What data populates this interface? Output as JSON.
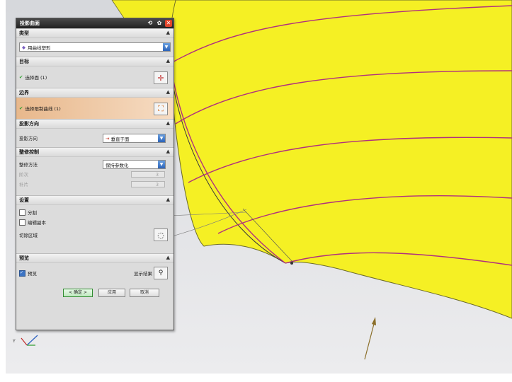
{
  "dialog": {
    "title": "投影曲面",
    "sections": {
      "type": {
        "header": "类型",
        "value": "用曲线塑形"
      },
      "target": {
        "header": "目标",
        "status": "选择面 (1)"
      },
      "boundary": {
        "header": "边界",
        "status": "选择限制曲线 (1)"
      },
      "projection": {
        "header": "投影方向",
        "label": "投影方向",
        "value": "垂直于面"
      },
      "shape_control": {
        "header": "整修控制",
        "method_label": "整修方法",
        "method_value": "保持参数化",
        "field1_label": "阶次",
        "field1_value": "3",
        "field2_label": "补片",
        "field2_value": "3"
      },
      "settings": {
        "header": "设置",
        "option1": "分割",
        "option2": "编辑副本",
        "trim_label": "切除区域"
      },
      "preview": {
        "header": "预览",
        "checkbox_label": "预览",
        "show_result": "显示结果"
      }
    },
    "buttons": {
      "ok": "< 确定 >",
      "apply": "应用",
      "cancel": "取消"
    }
  },
  "colors": {
    "surface": "#f5f024",
    "curve": "#b0307e",
    "viewport_bg": "#dfe0e3"
  },
  "icons": {
    "settings": "gear-icon",
    "reset": "reset-icon",
    "close": "close-icon"
  }
}
